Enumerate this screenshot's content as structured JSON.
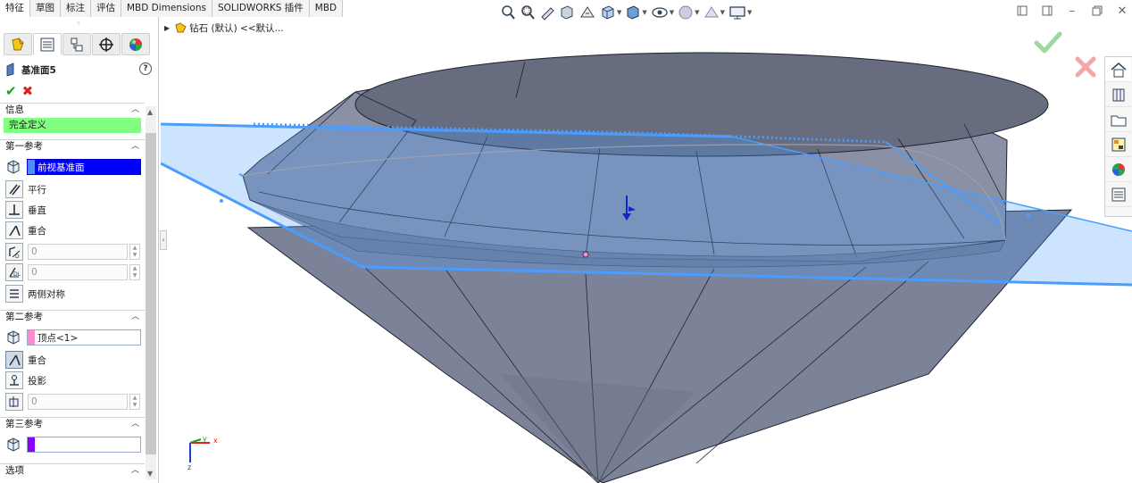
{
  "command_tabs": [
    "特征",
    "草图",
    "标注",
    "评估",
    "MBD Dimensions",
    "SOLIDWORKS 插件",
    "MBD"
  ],
  "active_command_tab": "特征",
  "panel": {
    "title": "基准面5",
    "help_label": "?",
    "info_group": {
      "header": "信息",
      "status": "完全定义"
    },
    "first_ref": {
      "header": "第一参考",
      "selection": "前视基准面",
      "options": [
        "平行",
        "垂直",
        "重合"
      ],
      "distance_value": "0",
      "angle_value": "0",
      "symmetric_label": "两侧对称"
    },
    "second_ref": {
      "header": "第二参考",
      "selection": "顶点<1>",
      "options": [
        "重合",
        "投影"
      ],
      "value": "0"
    },
    "third_ref": {
      "header": "第三参考",
      "selection": ""
    },
    "options_group": {
      "header": "选项"
    }
  },
  "tree_crumb": "钻石 (默认) <<默认...",
  "colors": {
    "accent_blue": "#0000ff",
    "status_green": "#80ff80",
    "selection_pink": "#ff8ad4",
    "third_purple": "#8a00ff",
    "plane_edge": "#4a9dff",
    "model_body": "#7c8398"
  },
  "triad_labels": {
    "x": "x",
    "y": "y",
    "z": "z"
  }
}
